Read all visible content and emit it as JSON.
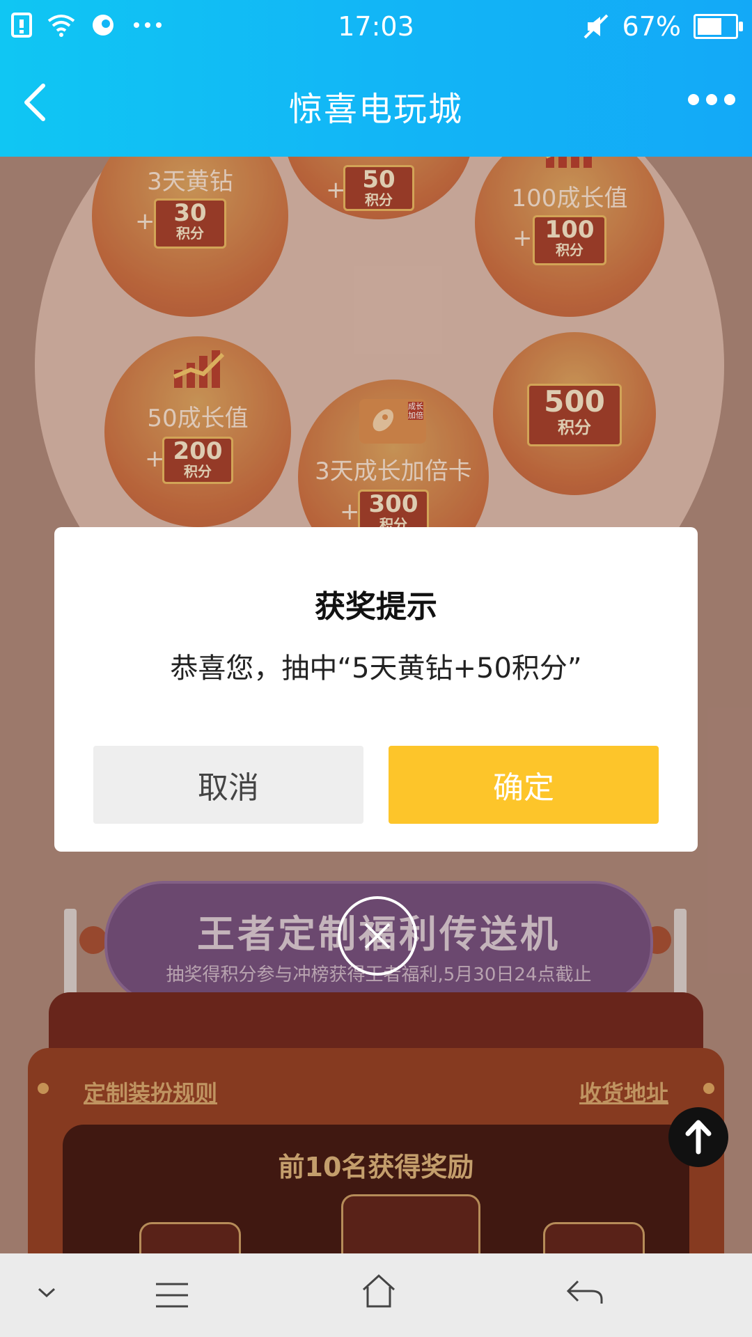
{
  "status_bar": {
    "time": "17:03",
    "battery_percent": "67%",
    "battery_level": 0.67,
    "icons": [
      "sim-icon",
      "wifi-icon",
      "message-icon",
      "more-dots-icon",
      "mute-icon",
      "battery-icon"
    ]
  },
  "nav": {
    "title": "惊喜电玩城",
    "back_icon": "chevron-left-icon",
    "more_icon": "more-horizontal-icon"
  },
  "wheel": {
    "prizes": [
      {
        "label": "3天黄钻",
        "plus": "+",
        "points": "30",
        "unit": "积分"
      },
      {
        "label": "",
        "plus": "+",
        "points": "50",
        "unit": "积分"
      },
      {
        "label": "100成长值",
        "plus": "+",
        "points": "100",
        "unit": "积分"
      },
      {
        "label": "50成长值",
        "plus": "+",
        "points": "200",
        "unit": "积分"
      },
      {
        "label": "3天成长加倍卡",
        "plus": "+",
        "points": "300",
        "unit": "积分",
        "card_badge": "成长加倍"
      },
      {
        "label": "",
        "plus": "",
        "points": "500",
        "unit": "积分"
      }
    ]
  },
  "banner": {
    "title": "王者定制福利传送机",
    "subtitle": "抽奖得积分参与冲榜获得王者福利,5月30日24点截止"
  },
  "machine": {
    "rules_link": "定制装扮规则",
    "address_link": "收货地址",
    "reward_title": "前10名获得奖励"
  },
  "dialog": {
    "title": "获奖提示",
    "message": "恭喜您，抽中“5天黄钻+50积分”",
    "cancel_label": "取消",
    "confirm_label": "确定"
  },
  "colors": {
    "topbar": "#12b6f6",
    "confirm": "#fdc52a",
    "cancel": "#eeeeee"
  },
  "bottom_nav": {
    "icons": [
      "chevron-down-icon",
      "menu-icon",
      "home-icon",
      "back-arrow-icon"
    ]
  }
}
